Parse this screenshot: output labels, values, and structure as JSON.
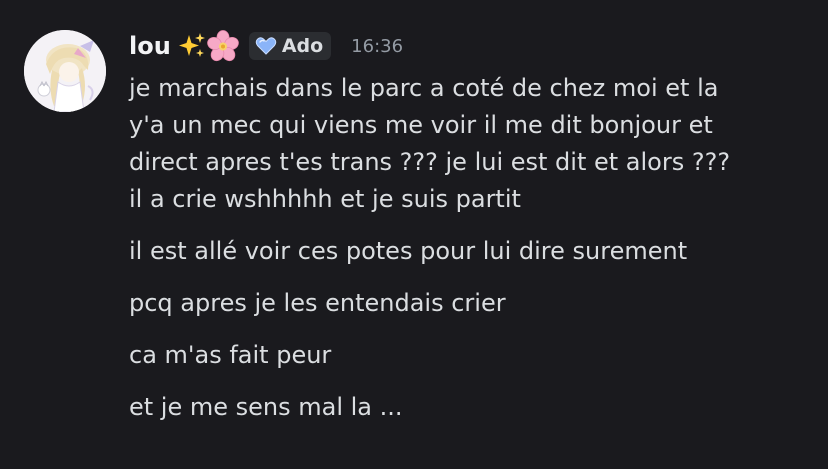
{
  "message": {
    "author": {
      "name": "lou",
      "emojis": [
        "sparkles-emoji",
        "cherry-blossom-emoji"
      ],
      "tag": {
        "icon": "heart-gem-icon",
        "label": "Ado"
      }
    },
    "timestamp": "16:36",
    "groups": [
      {
        "lines": [
          "je marchais dans le parc a coté de chez moi et la",
          "y'a un mec qui viens me voir il me dit bonjour et",
          "direct apres t'es trans ??? je lui est dit et alors ???",
          "il a crie wshhhhh et je suis partit"
        ]
      },
      {
        "lines": [
          "il est allé voir ces potes pour lui dire surement"
        ]
      },
      {
        "lines": [
          "pcq apres je les entendais crier"
        ]
      },
      {
        "lines": [
          "ca m'as fait peur"
        ]
      },
      {
        "lines": [
          "et je me sens mal la ..."
        ]
      }
    ]
  },
  "colors": {
    "background": "#1a1a1e",
    "text": "#dbdee1",
    "username": "#f2f3f5",
    "timestamp": "#949ba4",
    "tag_background": "#2b2d31",
    "tag_icon": "#8ab4f8"
  }
}
